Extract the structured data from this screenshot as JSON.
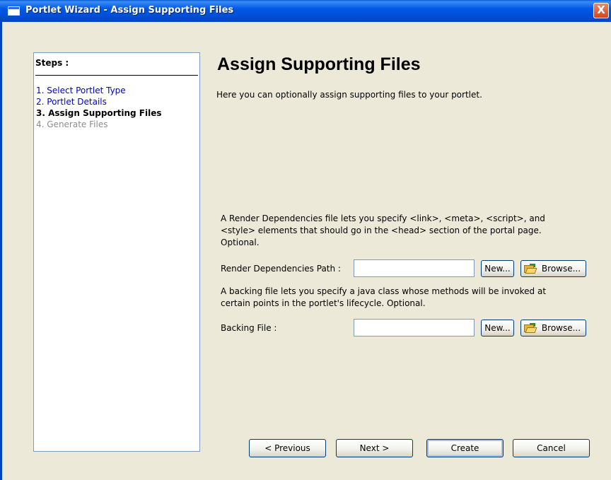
{
  "window": {
    "title": "Portlet Wizard - Assign Supporting Files",
    "close_glyph": "X"
  },
  "steps": {
    "heading": "Steps :",
    "items": [
      {
        "label": "1. Select Portlet Type",
        "state": "link"
      },
      {
        "label": "2. Portlet Details",
        "state": "link"
      },
      {
        "label": "3. Assign Supporting Files",
        "state": "current"
      },
      {
        "label": "4. Generate Files",
        "state": "disabled"
      }
    ]
  },
  "main": {
    "title": "Assign Supporting Files",
    "description": "Here you can optionally assign supporting files to your portlet.",
    "render_dependencies": {
      "help_line1": "A Render Dependencies file lets you specify <link>, <meta>, <script>, and",
      "help_line2": "<style> elements that should go in the <head> section of the portal page.",
      "help_line3": "Optional.",
      "label": "Render Dependencies Path :",
      "value": "",
      "new_label": "New...",
      "browse_label": "Browse..."
    },
    "backing_file": {
      "help_line1": "A backing file lets you specify a java class whose methods will be invoked at",
      "help_line2": "certain points in the portlet's lifecycle.  Optional.",
      "label": "Backing File :",
      "value": "",
      "new_label": "New...",
      "browse_label": "Browse..."
    }
  },
  "buttons": {
    "previous": "< Previous",
    "next": "Next >",
    "create": "Create",
    "cancel": "Cancel"
  },
  "icons": {
    "title": "window-icon",
    "close": "close-icon",
    "browse": "open-folder-icon"
  },
  "colors": {
    "titlebar": "#0058E6",
    "dialog_bg": "#ECE9D8",
    "link": "#0000CC",
    "disabled": "#8C8C8C"
  }
}
